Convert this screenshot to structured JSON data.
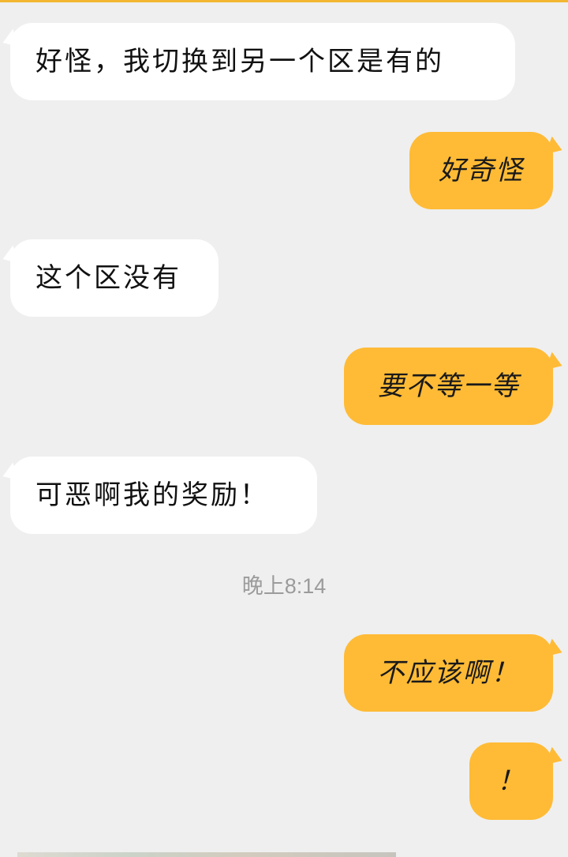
{
  "theme": {
    "background": "#efefef",
    "incoming_bubble": "#ffffff",
    "outgoing_bubble": "#ffbb36",
    "accent": "#f3b632",
    "timestamp_color": "#9b9b9b"
  },
  "messages": [
    {
      "direction": "incoming",
      "text": "好怪，我切换到另一个区是有的"
    },
    {
      "direction": "outgoing",
      "text": "好奇怪"
    },
    {
      "direction": "incoming",
      "text": "这个区没有"
    },
    {
      "direction": "outgoing",
      "text": "要不等一等"
    },
    {
      "direction": "incoming",
      "text": "可恶啊我的奖励！"
    },
    {
      "direction": "outgoing",
      "text": "不应该啊！"
    },
    {
      "direction": "outgoing",
      "text": "！"
    }
  ],
  "timestamp": "晚上8:14"
}
